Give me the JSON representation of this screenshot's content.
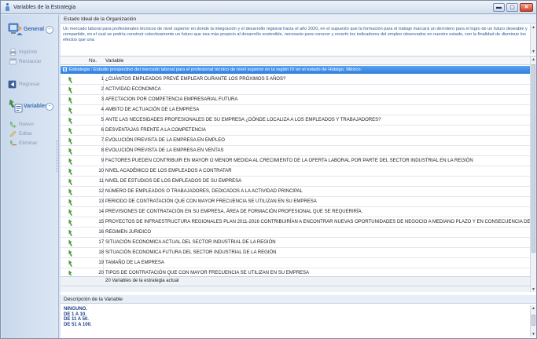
{
  "window": {
    "title": "Variables de la Estrategia",
    "minimize_glyph": "▬",
    "maximize_glyph": "▢",
    "close_glyph": "✕"
  },
  "sidebar": {
    "general": {
      "title": "General",
      "toggle": "⌃",
      "items": [
        {
          "label": "Imprimir",
          "icon": "printer-icon"
        },
        {
          "label": "Restaurar",
          "icon": "restore-icon"
        },
        {
          "label": "Regresar",
          "icon": "return-icon"
        }
      ]
    },
    "variables": {
      "title": "Variables",
      "toggle": "⌃",
      "items": [
        {
          "label": "Nuevo",
          "icon": "new-icon"
        },
        {
          "label": "Editar",
          "icon": "edit-icon"
        },
        {
          "label": "Eliminar",
          "icon": "delete-icon"
        }
      ]
    }
  },
  "organization": {
    "label": "Estado Ideal de la Organización",
    "text": "Un mercado laboral para profesionales técnicos de nivel superior en donde la integración y el desarrollo regional hacia el año 2020, en el supuesto que la formación para el trabajo marcará un derrotero para el logro de un futuro deseable y compartido, en el cual se podría construir colectivamente un futuro que sea más propicio al desarrollo sostenible, necesario para conocer y revertir los indicadores del empleo observados en nuestro estado, con la finalidad de disminuir los efectos que una"
  },
  "grid": {
    "col_no": "No.",
    "col_var": "Variable",
    "group": {
      "toggle": "−",
      "label": "Estrategia : Estudio prospectivo del mercado laboral para el profesional técnico de nivel superior en la región IV en el estado de Hidalgo, México."
    },
    "rows": [
      {
        "no": "1",
        "variable": "¿CUÁNTOS EMPLEADOS PREVÉ EMPLEAR DURANTE LOS PRÓXIMOS 5 AÑOS?"
      },
      {
        "no": "2",
        "variable": "ACTIVIDAD ECONOMICA"
      },
      {
        "no": "3",
        "variable": "AFECTACION POR COMPETENCIA EMPRESARIAL FUTURA"
      },
      {
        "no": "4",
        "variable": "AMBITO DE ACTUACIÓN DE LA EMPRESA"
      },
      {
        "no": "5",
        "variable": "ANTE LAS NECESIDADES PROFESIONALES DE SU EMPRESA ¿DÓNDE LOCALIZA A LOS EMPLEADOS Y TRABAJADORES?"
      },
      {
        "no": "6",
        "variable": "DESVENTAJAS FRENTE A LA COMPETENCIA"
      },
      {
        "no": "7",
        "variable": "EVOLUCIÓN PREVISTA DE LA EMPRESA EN EMPLEO"
      },
      {
        "no": "8",
        "variable": "EVOLUCIÓN PREVISTA DE LA EMPRESA EN VENTAS"
      },
      {
        "no": "9",
        "variable": "FACTORES PUEDEN CONTRIBUIR EN MAYOR O MENOR MEDIDA AL CRECIMIENTO DE LA OFERTA LABORAL POR PARTE DEL SECTOR INDUSTRIAL EN LA REGIÓN"
      },
      {
        "no": "10",
        "variable": "NIVEL ACADÉMICO DE LOS EMPLEADOS A CONTRATAR"
      },
      {
        "no": "11",
        "variable": "NIVEL DE ESTUDIOS DE LOS EMPLEADOS DE SU EMPRESA"
      },
      {
        "no": "12",
        "variable": "NÚMERO DE EMPLEADOS O TRABAJADORES, DEDICADOS A LA ACTIVIDAD PRINCIPAL"
      },
      {
        "no": "13",
        "variable": "PERIODO DE CONTRATACIÓN QUE CON MAYOR FRECUENCIA SE UTILIZAN EN SU EMPRESA"
      },
      {
        "no": "14",
        "variable": "PREVISIONES DE CONTRATACIÓN EN SU EMPRESA, ÁREA DE FORMACIÓN PROFESIONAL QUE SE REQUERIRÍA."
      },
      {
        "no": "15",
        "variable": "PROYECTOS DE INFRAESTRUCTURA REGIONALES PLAN 2011-2016 CONTRIBUIRÍAN A ENCONTRAR NUEVAS OPORTUNIDADES DE NEGOCIO A MEDIANO PLAZO Y EN CONSECUENCIA DEMANDA LABORAL"
      },
      {
        "no": "16",
        "variable": "REGIMEN JURIDICO"
      },
      {
        "no": "17",
        "variable": "SITUACIÓN ECONOMICA ACTUAL DEL SECTOR INDUSTRIAL DE LA REGIÓN"
      },
      {
        "no": "18",
        "variable": "SITUACIÓN ECONOMICA FUTURA DEL SECTOR INDUSTRIAL DE LA REGIÓN"
      },
      {
        "no": "19",
        "variable": "TAMAÑO DE LA EMPRESA"
      },
      {
        "no": "20",
        "variable": "TIPOS DE CONTRATACIÓN QUE CON MAYOR FRECUENCIA SE UTILIZAN EN SU EMPRESA"
      }
    ],
    "footer": "20 Variables de la estrategia actual"
  },
  "description": {
    "label": "Descripción de la Variable",
    "lines": [
      "NINGUNO.",
      "DE 1 A 10.",
      "DE 11 A 50.",
      "DE 51 A 100."
    ]
  },
  "colors": {
    "group_row": "#2f7fe0",
    "org_text": "#2a5a9a",
    "desc_text": "#1a3f88",
    "row_icon": "#4a9a3a"
  }
}
